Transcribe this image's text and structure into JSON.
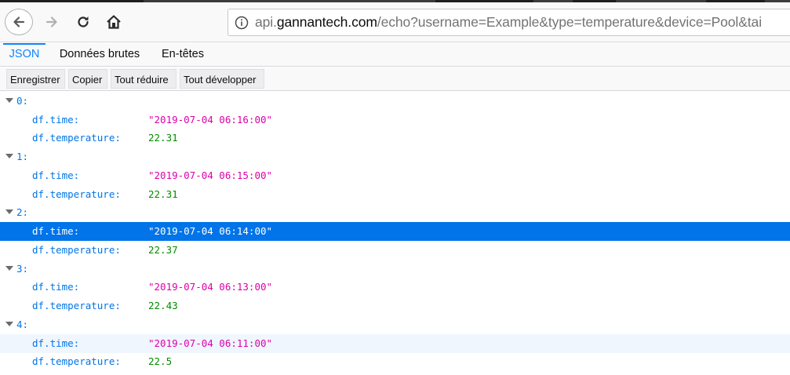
{
  "browser": {
    "url_prefix": "api.",
    "url_host": "gannantech.com",
    "url_rest": "/echo?username=Example&type=temperature&device=Pool&tai"
  },
  "viewer_tabs": [
    "JSON",
    "Données brutes",
    "En-têtes"
  ],
  "toolbar": {
    "save_label": "Enregistrer",
    "copy_label": "Copier",
    "collapse_label": "Tout réduire",
    "expand_label": "Tout développer"
  },
  "records": [
    {
      "index": "0:",
      "time_key": "df.time:",
      "time": "\"2019-07-04 06:16:00\"",
      "temp_key": "df.temperature:",
      "temperature": "22.31"
    },
    {
      "index": "1:",
      "time_key": "df.time:",
      "time": "\"2019-07-04 06:15:00\"",
      "temp_key": "df.temperature:",
      "temperature": "22.31"
    },
    {
      "index": "2:",
      "time_key": "df.time:",
      "time": "\"2019-07-04 06:14:00\"",
      "temp_key": "df.temperature:",
      "temperature": "22.37"
    },
    {
      "index": "3:",
      "time_key": "df.time:",
      "time": "\"2019-07-04 06:13:00\"",
      "temp_key": "df.temperature:",
      "temperature": "22.43"
    },
    {
      "index": "4:",
      "time_key": "df.time:",
      "time": "\"2019-07-04 06:11:00\"",
      "temp_key": "df.temperature:",
      "temperature": "22.5"
    }
  ],
  "colors": {
    "key": "#0074e8",
    "string": "#dd00a9",
    "number": "#058b00",
    "selection": "#0074e8",
    "accent": "#0a84ff"
  }
}
